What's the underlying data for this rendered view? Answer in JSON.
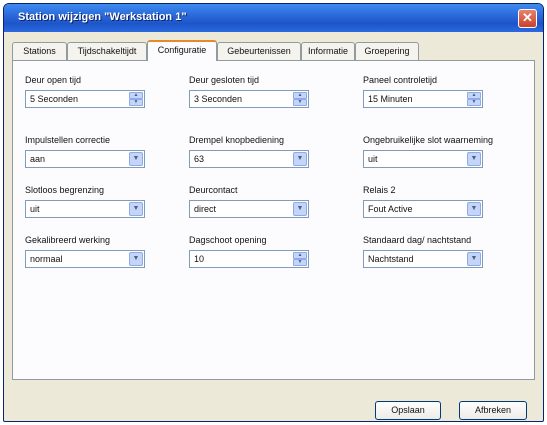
{
  "window": {
    "title": "Station wijzigen \"Werkstation 1\"",
    "close_glyph": "✕"
  },
  "tabs": [
    {
      "label": "Stations"
    },
    {
      "label": "Tijdschakeltijdt"
    },
    {
      "label": "Configuratie"
    },
    {
      "label": "Gebeurtenissen"
    },
    {
      "label": "Informatie"
    },
    {
      "label": "Groepering"
    }
  ],
  "active_tab": "Configuratie",
  "fields": {
    "deur_open_tijd": {
      "label": "Deur open tijd",
      "value": "5 Seconden",
      "control": "spinner"
    },
    "deur_gesloten_tijd": {
      "label": "Deur gesloten tijd",
      "value": "3 Seconden",
      "control": "spinner"
    },
    "paneel_controletijd": {
      "label": "Paneel controletijd",
      "value": "15 Minuten",
      "control": "spinner"
    },
    "impulstellen_correctie": {
      "label": "Impulstellen correctie",
      "value": "aan",
      "control": "dropdown"
    },
    "drempel_knopbediening": {
      "label": "Drempel knopbediening",
      "value": "63",
      "control": "dropdown"
    },
    "ongebruikelijke_slot_waarneming": {
      "label": "Ongebruikelijke slot waarneming",
      "value": "uit",
      "control": "dropdown"
    },
    "slotloos_begrenzing": {
      "label": "Slotloos begrenzing",
      "value": "uit",
      "control": "dropdown"
    },
    "deurcontact": {
      "label": "Deurcontact",
      "value": "direct",
      "control": "dropdown"
    },
    "relais_2": {
      "label": "Relais 2",
      "value": "Fout Active",
      "control": "dropdown"
    },
    "gekalibreerd_werking": {
      "label": "Gekalibreerd werking",
      "value": "normaal",
      "control": "dropdown"
    },
    "dagschoot_opening": {
      "label": "Dagschoot opening",
      "value": "10",
      "control": "spinner"
    },
    "standaard_dag_nachtstand": {
      "label": "Standaard dag/ nachtstand",
      "value": "Nachtstand",
      "control": "dropdown"
    }
  },
  "buttons": {
    "save_label": "Opslaan",
    "cancel_label": "Afbreken"
  },
  "glyphs": {
    "spin_up": "▲",
    "spin_down": "▼",
    "dropdown": "▼"
  },
  "colors": {
    "titlebar": "#2a66d8",
    "dialog_bg": "#ece9d8",
    "active_tab_accent": "#e68b2c",
    "close_button": "#c8412c"
  }
}
